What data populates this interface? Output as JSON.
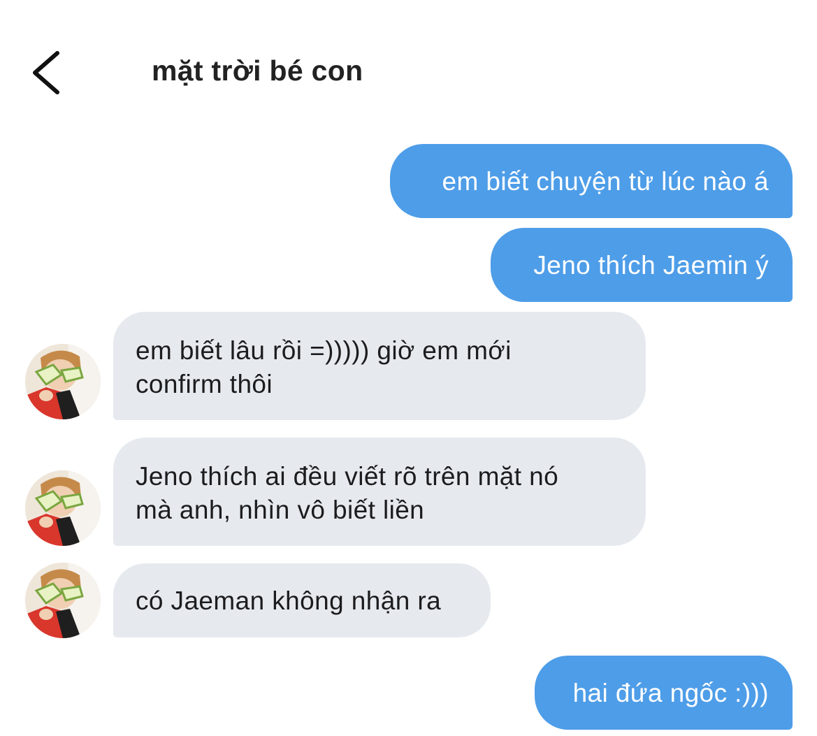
{
  "header": {
    "title": "mặt trời bé con"
  },
  "messages": [
    {
      "direction": "outgoing",
      "text": "em biết chuyện từ lúc nào á"
    },
    {
      "direction": "outgoing",
      "text": "Jeno thích Jaemin ý"
    },
    {
      "direction": "incoming",
      "lines": [
        "em biết lâu rồi =))))) giờ em mới",
        "confirm thôi"
      ]
    },
    {
      "direction": "incoming",
      "lines": [
        "Jeno thích ai đều viết rõ trên mặt nó",
        "mà anh, nhìn vô biết liền"
      ]
    },
    {
      "direction": "incoming",
      "text": "có Jaeman không nhận ra"
    },
    {
      "direction": "outgoing",
      "text": "hai đứa ngốc :)))"
    }
  ],
  "icons": {
    "back": "chevron-left-icon"
  },
  "colors": {
    "outgoing_bubble": "#4e9de8",
    "incoming_bubble": "#e6eaef",
    "title_text": "#222222"
  }
}
